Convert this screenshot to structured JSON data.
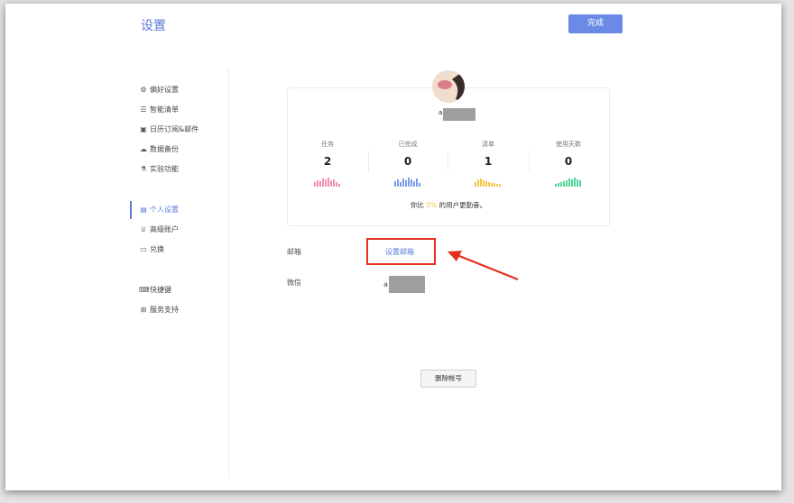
{
  "header": {
    "title": "设置",
    "done_label": "完成"
  },
  "sidebar": {
    "groups": [
      [
        {
          "icon": "gear-icon",
          "label": "偏好设置"
        },
        {
          "icon": "smart-list-icon",
          "label": "智能清单"
        },
        {
          "icon": "calendar-icon",
          "label": "日历订阅&邮件"
        },
        {
          "icon": "cloud-icon",
          "label": "数据备份"
        },
        {
          "icon": "lab-icon",
          "label": "实验功能"
        }
      ],
      [
        {
          "icon": "profile-icon",
          "label": "个人设置",
          "active": true
        },
        {
          "icon": "crown-icon",
          "label": "高级账户"
        },
        {
          "icon": "ticket-icon",
          "label": "兑换"
        }
      ],
      [
        {
          "icon": "keyboard-icon",
          "label": "快捷键"
        },
        {
          "icon": "support-icon",
          "label": "服务支持"
        }
      ]
    ]
  },
  "profile": {
    "username_initial": "a",
    "stats": [
      {
        "label": "任务",
        "value": "2",
        "color": "#f08fb0"
      },
      {
        "label": "已完成",
        "value": "0",
        "color": "#7f9be8"
      },
      {
        "label": "清单",
        "value": "1",
        "color": "#f3c849"
      },
      {
        "label": "使用天数",
        "value": "0",
        "color": "#4fd49b"
      }
    ],
    "compare_prefix": "你比",
    "compare_pct": "0%",
    "compare_suffix": "的用户更勤奋。"
  },
  "account": {
    "email_label": "邮箱",
    "email_link": "设置邮箱",
    "wechat_label": "微信",
    "wechat_value_initial": "a"
  },
  "delete_label": "删除帐号"
}
